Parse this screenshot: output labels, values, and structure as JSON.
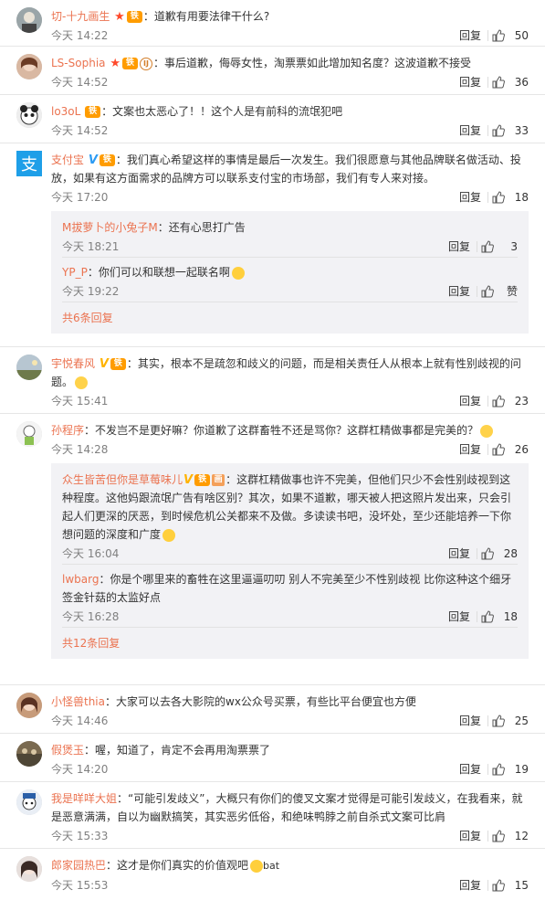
{
  "labels": {
    "reply": "回复",
    "like_icon": "thumb-up-icon"
  },
  "colors": {
    "name": "#eb7350",
    "meta": "#808080",
    "sub_bg": "#f2f2f5"
  },
  "comments": [
    {
      "name": "切-十九画生",
      "text": "：道歉有用要法律干什么?",
      "time": "今天 14:22",
      "likes": "50"
    },
    {
      "name": "LS-Sophia",
      "text": "：事后道歉，侮辱女性，淘票票如此增加知名度？这波道歉不接受",
      "time": "今天 14:52",
      "likes": "36"
    },
    {
      "name": "lo3oL",
      "text": "：文案也太恶心了！！这个人是有前科的流氓犯吧",
      "time": "今天 14:52",
      "likes": "33"
    },
    {
      "name": "支付宝",
      "text": "：我们真心希望这样的事情是最后一次发生。我们很愿意与其他品牌联名做活动、投放，如果有这方面需求的品牌方可以联系支付宝的市场部，我们有专人来对接。",
      "time": "今天 17:20",
      "likes": "18",
      "replies": [
        {
          "name": "M拔萝卜的小兔子M",
          "text": "：还有心思打广告",
          "time": "今天 18:21",
          "likes": "3"
        },
        {
          "name": "YP_P",
          "text": "：你们可以和联想一起联名啊",
          "time": "今天 19:22",
          "likes": "赞"
        }
      ],
      "more": "共6条回复"
    },
    {
      "name": "宇悦春风",
      "text": "：其实，根本不是疏忽和歧义的问题，而是相关责任人从根本上就有性别歧视的问题。",
      "time": "今天 15:41",
      "likes": "23"
    },
    {
      "name": "孙程序",
      "text": "：不发岂不是更好嘛？你道歉了这群畜牲不还是骂你？这群杠精做事都是完美的？",
      "time": "今天 14:28",
      "likes": "26",
      "replies": [
        {
          "name": "众生皆苦但你是草莓味儿",
          "text": "：这群杠精做事也许不完美，但他们只少不会性别歧视到这种程度。这他妈跟流氓广告有啥区别？其次，如果不道歉，哪天被人把这照片发出来，只会引起人们更深的厌恶，到时候危机公关都来不及做。多读读书吧，没坏处，至少还能培养一下你想问题的深度和广度",
          "time": "今天 16:04",
          "likes": "28"
        },
        {
          "name": "lwbarg",
          "text": "：你是个哪里来的畜牲在这里逼逼叨叨 别人不完美至少不性别歧视 比你这种这个细牙签金针菇的太监好点",
          "time": "今天 16:28",
          "likes": "18"
        }
      ],
      "more": "共12条回复"
    },
    {
      "name": "小怪兽thia",
      "text": "：大家可以去各大影院的wx公众号买票，有些比平台便宜也方便",
      "time": "今天 14:46",
      "likes": "25"
    },
    {
      "name": "假煲玉",
      "text": "：喔，知道了，肯定不会再用淘票票了",
      "time": "今天 14:20",
      "likes": "19"
    },
    {
      "name": "我是咩咩大姐",
      "text": "：“可能引发歧义”，大概只有你们的傻叉文案才觉得是可能引发歧义，在我看来，就是恶意满满，自以为幽默搞笑，其实恶劣低俗，和绝味鸭脖之前自杀式文案可比肩",
      "time": "今天 15:33",
      "likes": "12"
    },
    {
      "name": "郎家园热巴",
      "text": "：这才是你们真实的价值观吧",
      "suffix": "bat",
      "time": "今天 15:53",
      "likes": "15"
    }
  ]
}
